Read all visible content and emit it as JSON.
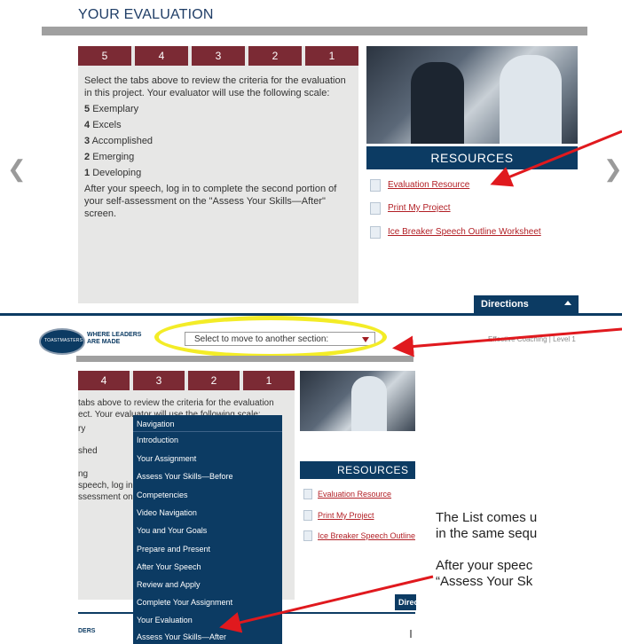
{
  "evaluation": {
    "title": "YOUR EVALUATION",
    "tabs": [
      "5",
      "4",
      "3",
      "2",
      "1"
    ],
    "intro": "Select the tabs above to review the criteria for the evaluation in this project. Your evaluator will use the following scale:",
    "scale": [
      {
        "num": "5",
        "label": "Exemplary"
      },
      {
        "num": "4",
        "label": "Excels"
      },
      {
        "num": "3",
        "label": "Accomplished"
      },
      {
        "num": "2",
        "label": "Emerging"
      },
      {
        "num": "1",
        "label": "Developing"
      }
    ],
    "after_note": "After your speech, log in to complete the second portion of your self-assessment on the \"Assess Your Skills—After\" screen."
  },
  "resources": {
    "header": "RESOURCES",
    "links": [
      "Evaluation Resource",
      "Print My Project",
      "Ice Breaker Speech Outline Worksheet"
    ]
  },
  "nav": {
    "prev_glyph": "❮",
    "next_glyph": "❯"
  },
  "directions_label": "Directions",
  "header2": {
    "logo_text": "TOASTMASTERS",
    "tagline_line1": "WHERE LEADERS",
    "tagline_line2": "ARE MADE",
    "select_placeholder": "Select to move to another section:",
    "effective_text": "Effective Coaching | Level 1"
  },
  "panel2": {
    "tabs": [
      "4",
      "3",
      "2",
      "1"
    ],
    "lines": [
      "tabs above to review the criteria for the evaluation",
      "ect. Your evaluator will use the following scale:",
      "ry",
      "",
      "shed",
      "",
      "ng",
      "speech, log in",
      "ssessment on"
    ],
    "resources_header": "RESOURCES",
    "links": [
      "Evaluation Resource",
      "Print My Project",
      "Ice Breaker Speech Outline Worksheet"
    ],
    "directions_short": "Directions",
    "footer_text": "DERS"
  },
  "dropdown": {
    "items": [
      "Navigation",
      "Introduction",
      "Your Assignment",
      "Assess Your Skills—Before",
      "Competencies",
      "Video Navigation",
      "You and Your Goals",
      "Prepare and Present",
      "After Your Speech",
      "Review and Apply",
      "Complete Your Assignment",
      "Your Evaluation",
      "Assess Your Skills—After"
    ]
  },
  "captions": {
    "line1": "The List comes u",
    "line2": "in the same sequ",
    "line3": "After your speec",
    "line4": "“Assess Your Sk"
  },
  "colors": {
    "maroon": "#7b2a34",
    "navy": "#0c3b63",
    "panel_bg": "#e7e7e6",
    "link_red": "#b21f25",
    "highlight_yellow": "#f3ec27",
    "arrow_red": "#e0191e"
  }
}
